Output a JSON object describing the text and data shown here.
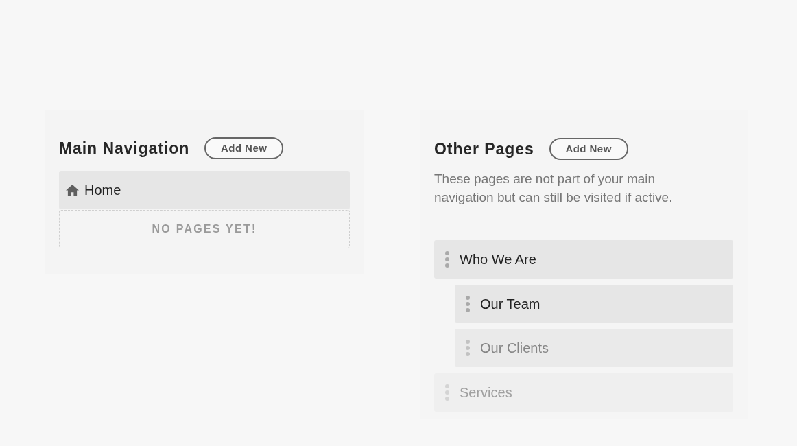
{
  "main_navigation": {
    "title": "Main Navigation",
    "add_button": "Add New",
    "items": [
      {
        "label": "Home",
        "kind": "home"
      }
    ],
    "empty_state": "NO PAGES YET!"
  },
  "other_pages": {
    "title": "Other Pages",
    "add_button": "Add New",
    "description": "These pages are not part of your main navigation but can still be visited if active.",
    "items": [
      {
        "label": "Who We Are",
        "children": [
          {
            "label": "Our Team"
          },
          {
            "label": "Our Clients"
          }
        ]
      },
      {
        "label": "Services"
      }
    ]
  }
}
